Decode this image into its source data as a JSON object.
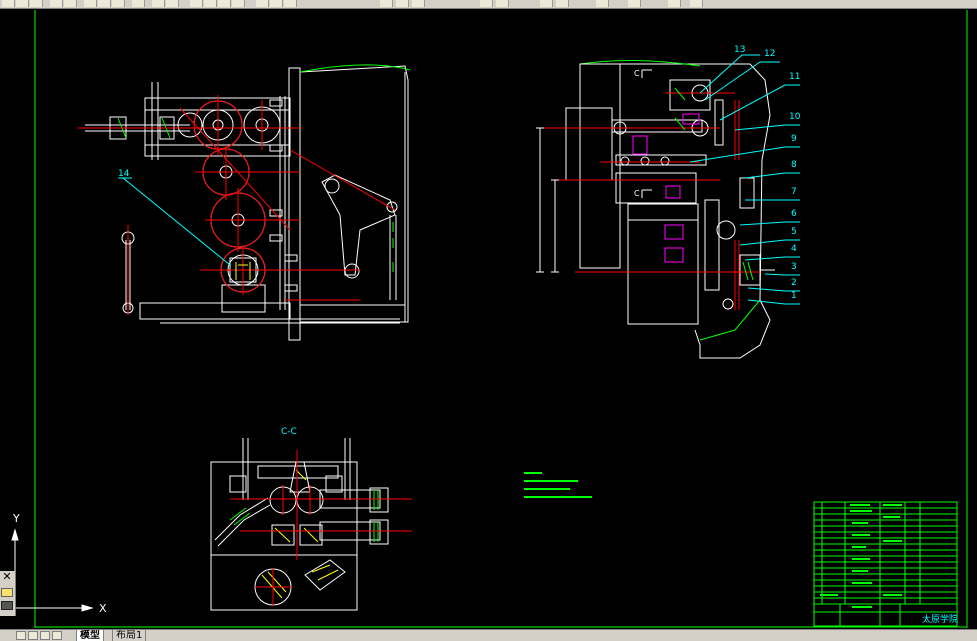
{
  "tabs": {
    "model": "模型",
    "layout1": "布局1"
  },
  "ucs": {
    "y_label": "Y",
    "x_label": "X"
  },
  "drawing": {
    "section_label": "C-C",
    "section_marker": "C",
    "balloons_main": [
      "14"
    ],
    "balloons_side": [
      "13",
      "12",
      "11",
      "10",
      "9",
      "8",
      "7",
      "6",
      "5",
      "4",
      "3",
      "2",
      "1"
    ],
    "title_block_name": "太原学院"
  },
  "colors": {
    "background": "#000000",
    "frame": "#00ff00",
    "geometry": "#ffffff",
    "centerline": "#ff0000",
    "balloon": "#00ffff",
    "hidden": "#ff00ff",
    "hatch": "#ffff00",
    "toolbar": "#d4d0c8"
  }
}
